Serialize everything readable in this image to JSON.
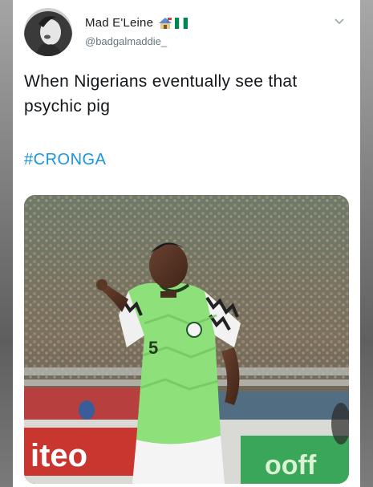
{
  "tweet": {
    "display_name": "Mad E'Leine",
    "handle": "@badgalmaddie_",
    "text": "When Nigerians eventually see that psychic pig",
    "hashtag": "#CRONGA",
    "name_emojis": [
      "house-with-flag-emoji",
      "nigeria-flag-emoji"
    ],
    "menu_icon": "chevron-down-icon",
    "media": {
      "description_icon": "photo",
      "jersey_number": "5",
      "ad_board_text": "iteo",
      "ad_board_text_right": "ooff"
    }
  },
  "colors": {
    "hashtag": "#1b95e0",
    "handle": "#66757f",
    "text": "#14171a",
    "jersey_green": "#8ee07a",
    "nigeria_green": "#008751"
  }
}
